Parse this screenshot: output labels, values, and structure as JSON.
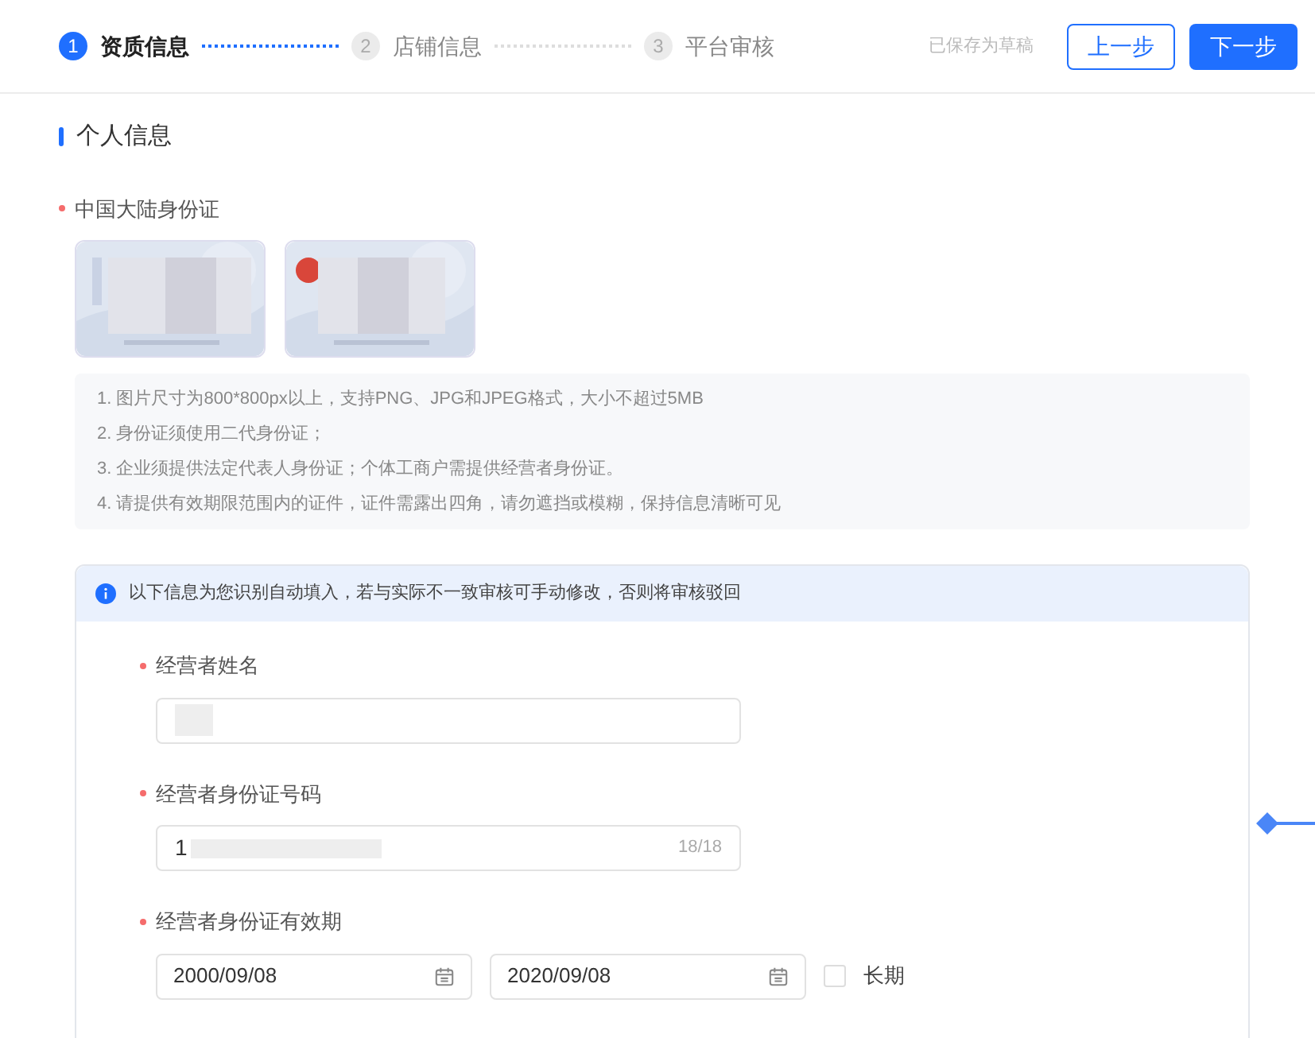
{
  "steps": [
    {
      "number": "1",
      "label": "资质信息",
      "selected": true
    },
    {
      "number": "2",
      "label": "店铺信息",
      "selected": false
    },
    {
      "number": "3",
      "label": "平台审核",
      "selected": false
    }
  ],
  "header": {
    "draft_status": "已保存为草稿",
    "buttons": [
      {
        "label": "上一步",
        "kind": "secondary"
      },
      {
        "label": "下一步",
        "kind": "primary"
      }
    ]
  },
  "section": {
    "title": "个人信息"
  },
  "id_upload": {
    "label": "中国大陆身份证",
    "required": true,
    "tips": [
      "1. 图片尺寸为800*800px以上，支持PNG、JPG和JPEG格式，大小不超过5MB",
      "2. 身份证须使用二代身份证；",
      "3. 企业须提供法定代表人身份证；个体工商户需提供经营者身份证。",
      "4. 请提供有效期限范围内的证件，证件需露出四角，请勿遮挡或模糊，保持信息清晰可见"
    ]
  },
  "notice": "以下信息为您识别自动填入，若与实际不一致审核可手动修改，否则将审核驳回",
  "fields": [
    {
      "kind": "text",
      "label": "经营者姓名",
      "required": true,
      "redacted": true
    },
    {
      "kind": "text",
      "label": "经营者身份证号码",
      "required": true,
      "value": "1",
      "redacted": true,
      "counter": "18/18"
    },
    {
      "kind": "daterange",
      "label": "经营者身份证有效期",
      "required": true,
      "start": "2000/09/08",
      "end": "2020/09/08",
      "checkbox": {
        "label": "长期",
        "checked": false
      }
    }
  ]
}
